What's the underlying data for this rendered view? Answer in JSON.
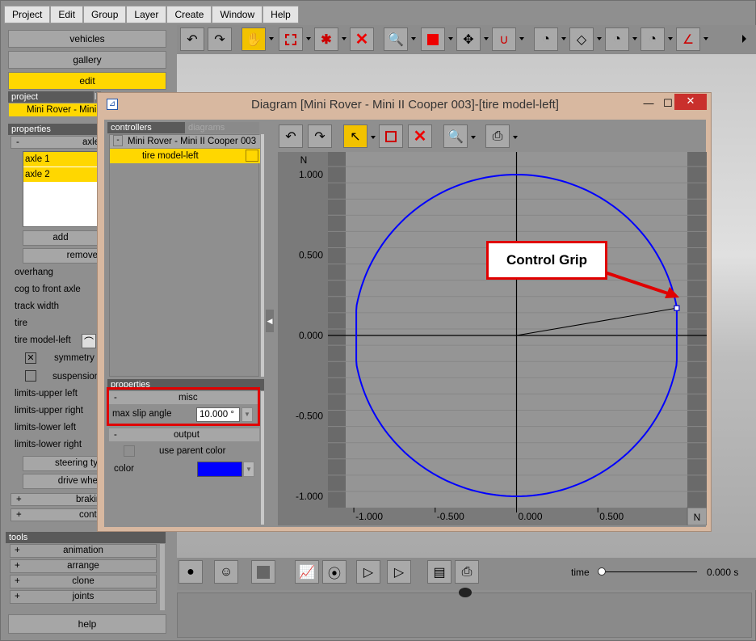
{
  "menubar": {
    "items": [
      "Project",
      "Edit",
      "Group",
      "Layer",
      "Create",
      "Window",
      "Help"
    ]
  },
  "leftpanel": {
    "tabs": [
      "vehicles",
      "gallery",
      "edit"
    ],
    "project_header": "project",
    "project_header_tab2": "la",
    "project_name": "Mini Rover - Mini",
    "properties_header": "properties",
    "axles_label": "axles",
    "axle_list": [
      "axle 1",
      "axle 2"
    ],
    "add_label": "add",
    "remove_label": "remove",
    "prop_labels": [
      "overhang",
      "cog to front axle",
      "track width",
      "tire",
      "tire model-left"
    ],
    "symmetry_label": "symmetry",
    "suspension_label": "suspension",
    "limit_labels": [
      "limits-upper left",
      "limits-upper right",
      "limits-lower left",
      "limits-lower right"
    ],
    "steering_label": "steering ty",
    "drive_label": "drive whe",
    "braking_label": "brakin",
    "contact_label": "conta",
    "tools_header": "tools",
    "tools": [
      "animation",
      "arrange",
      "clone",
      "joints"
    ],
    "help_label": "help"
  },
  "diagram": {
    "title": "Diagram [Mini Rover - Mini II Cooper 003]-[tire model-left]",
    "tabs": [
      "controllers",
      "diagrams"
    ],
    "tree_root": "Mini Rover - Mini II Cooper 003",
    "tree_child": "tire model-left",
    "properties_header": "properties",
    "misc_label": "misc",
    "max_slip_label": "max slip angle",
    "max_slip_value": "10.000 °",
    "output_label": "output",
    "use_parent_color_label": "use parent color",
    "color_label": "color",
    "color_value": "#0000ff"
  },
  "chart_data": {
    "type": "line",
    "title": "",
    "ylabel": "N",
    "xlabel": "N",
    "ylim": [
      -1.0,
      1.0
    ],
    "xlim": [
      -1.05,
      1.05
    ],
    "y_ticks": [
      "1.000",
      "0.500",
      "0.000",
      "-0.500",
      "-1.000"
    ],
    "x_ticks": [
      "-1.000",
      "-0.500",
      "0.000",
      "0.500"
    ],
    "curve_color": "#0000ff",
    "control_grip": {
      "x": 0.985,
      "y": 0.17
    }
  },
  "callout": {
    "label": "Control Grip"
  },
  "bottombar": {
    "time_label": "time",
    "time_value": "0.000 s"
  }
}
